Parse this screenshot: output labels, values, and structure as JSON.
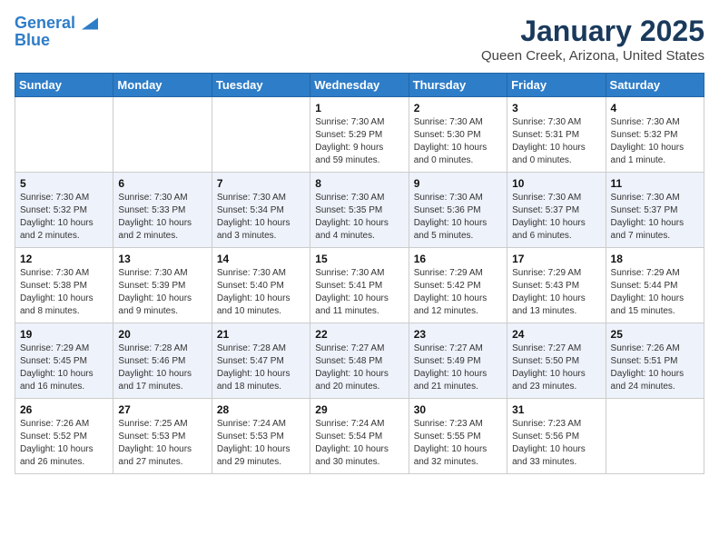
{
  "header": {
    "logo_line1": "General",
    "logo_line2": "Blue",
    "title": "January 2025",
    "subtitle": "Queen Creek, Arizona, United States"
  },
  "weekdays": [
    "Sunday",
    "Monday",
    "Tuesday",
    "Wednesday",
    "Thursday",
    "Friday",
    "Saturday"
  ],
  "weeks": [
    [
      {
        "num": "",
        "info": ""
      },
      {
        "num": "",
        "info": ""
      },
      {
        "num": "",
        "info": ""
      },
      {
        "num": "1",
        "info": "Sunrise: 7:30 AM\nSunset: 5:29 PM\nDaylight: 9 hours\nand 59 minutes."
      },
      {
        "num": "2",
        "info": "Sunrise: 7:30 AM\nSunset: 5:30 PM\nDaylight: 10 hours\nand 0 minutes."
      },
      {
        "num": "3",
        "info": "Sunrise: 7:30 AM\nSunset: 5:31 PM\nDaylight: 10 hours\nand 0 minutes."
      },
      {
        "num": "4",
        "info": "Sunrise: 7:30 AM\nSunset: 5:32 PM\nDaylight: 10 hours\nand 1 minute."
      }
    ],
    [
      {
        "num": "5",
        "info": "Sunrise: 7:30 AM\nSunset: 5:32 PM\nDaylight: 10 hours\nand 2 minutes."
      },
      {
        "num": "6",
        "info": "Sunrise: 7:30 AM\nSunset: 5:33 PM\nDaylight: 10 hours\nand 2 minutes."
      },
      {
        "num": "7",
        "info": "Sunrise: 7:30 AM\nSunset: 5:34 PM\nDaylight: 10 hours\nand 3 minutes."
      },
      {
        "num": "8",
        "info": "Sunrise: 7:30 AM\nSunset: 5:35 PM\nDaylight: 10 hours\nand 4 minutes."
      },
      {
        "num": "9",
        "info": "Sunrise: 7:30 AM\nSunset: 5:36 PM\nDaylight: 10 hours\nand 5 minutes."
      },
      {
        "num": "10",
        "info": "Sunrise: 7:30 AM\nSunset: 5:37 PM\nDaylight: 10 hours\nand 6 minutes."
      },
      {
        "num": "11",
        "info": "Sunrise: 7:30 AM\nSunset: 5:37 PM\nDaylight: 10 hours\nand 7 minutes."
      }
    ],
    [
      {
        "num": "12",
        "info": "Sunrise: 7:30 AM\nSunset: 5:38 PM\nDaylight: 10 hours\nand 8 minutes."
      },
      {
        "num": "13",
        "info": "Sunrise: 7:30 AM\nSunset: 5:39 PM\nDaylight: 10 hours\nand 9 minutes."
      },
      {
        "num": "14",
        "info": "Sunrise: 7:30 AM\nSunset: 5:40 PM\nDaylight: 10 hours\nand 10 minutes."
      },
      {
        "num": "15",
        "info": "Sunrise: 7:30 AM\nSunset: 5:41 PM\nDaylight: 10 hours\nand 11 minutes."
      },
      {
        "num": "16",
        "info": "Sunrise: 7:29 AM\nSunset: 5:42 PM\nDaylight: 10 hours\nand 12 minutes."
      },
      {
        "num": "17",
        "info": "Sunrise: 7:29 AM\nSunset: 5:43 PM\nDaylight: 10 hours\nand 13 minutes."
      },
      {
        "num": "18",
        "info": "Sunrise: 7:29 AM\nSunset: 5:44 PM\nDaylight: 10 hours\nand 15 minutes."
      }
    ],
    [
      {
        "num": "19",
        "info": "Sunrise: 7:29 AM\nSunset: 5:45 PM\nDaylight: 10 hours\nand 16 minutes."
      },
      {
        "num": "20",
        "info": "Sunrise: 7:28 AM\nSunset: 5:46 PM\nDaylight: 10 hours\nand 17 minutes."
      },
      {
        "num": "21",
        "info": "Sunrise: 7:28 AM\nSunset: 5:47 PM\nDaylight: 10 hours\nand 18 minutes."
      },
      {
        "num": "22",
        "info": "Sunrise: 7:27 AM\nSunset: 5:48 PM\nDaylight: 10 hours\nand 20 minutes."
      },
      {
        "num": "23",
        "info": "Sunrise: 7:27 AM\nSunset: 5:49 PM\nDaylight: 10 hours\nand 21 minutes."
      },
      {
        "num": "24",
        "info": "Sunrise: 7:27 AM\nSunset: 5:50 PM\nDaylight: 10 hours\nand 23 minutes."
      },
      {
        "num": "25",
        "info": "Sunrise: 7:26 AM\nSunset: 5:51 PM\nDaylight: 10 hours\nand 24 minutes."
      }
    ],
    [
      {
        "num": "26",
        "info": "Sunrise: 7:26 AM\nSunset: 5:52 PM\nDaylight: 10 hours\nand 26 minutes."
      },
      {
        "num": "27",
        "info": "Sunrise: 7:25 AM\nSunset: 5:53 PM\nDaylight: 10 hours\nand 27 minutes."
      },
      {
        "num": "28",
        "info": "Sunrise: 7:24 AM\nSunset: 5:53 PM\nDaylight: 10 hours\nand 29 minutes."
      },
      {
        "num": "29",
        "info": "Sunrise: 7:24 AM\nSunset: 5:54 PM\nDaylight: 10 hours\nand 30 minutes."
      },
      {
        "num": "30",
        "info": "Sunrise: 7:23 AM\nSunset: 5:55 PM\nDaylight: 10 hours\nand 32 minutes."
      },
      {
        "num": "31",
        "info": "Sunrise: 7:23 AM\nSunset: 5:56 PM\nDaylight: 10 hours\nand 33 minutes."
      },
      {
        "num": "",
        "info": ""
      }
    ]
  ]
}
